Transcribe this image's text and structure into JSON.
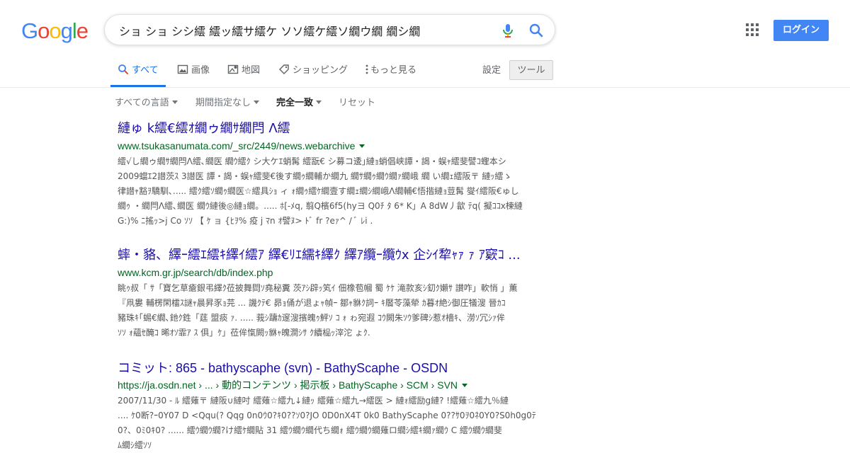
{
  "header": {
    "logo_letters": [
      {
        "ch": "G",
        "color": "#4285f4"
      },
      {
        "ch": "o",
        "color": "#ea4335"
      },
      {
        "ch": "o",
        "color": "#fbbc05"
      },
      {
        "ch": "g",
        "color": "#4285f4"
      },
      {
        "ch": "l",
        "color": "#34a853"
      },
      {
        "ch": "e",
        "color": "#ea4335"
      }
    ],
    "search_value": "ショ ショ シシ繧 繧ッ繧サ繧ケ ソソ繧ケ繧ソ繝ウ繝 繝シ繝",
    "login_label": "ログイン",
    "mic_icon": "mic-icon",
    "search_icon": "search-icon",
    "apps_icon": "apps-grid-icon"
  },
  "tabs": [
    {
      "label": "すべて",
      "icon": "search-icon",
      "active": true
    },
    {
      "label": "画像",
      "icon": "image-icon",
      "active": false
    },
    {
      "label": "地図",
      "icon": "map-icon",
      "active": false
    },
    {
      "label": "ショッピング",
      "icon": "tag-icon",
      "active": false
    },
    {
      "label": "もっと見る",
      "icon": "more-vert-icon",
      "active": false
    }
  ],
  "settings_label": "設定",
  "tools_label": "ツール",
  "filters": [
    {
      "label": "すべての言語",
      "dropdown": true
    },
    {
      "label": "期間指定なし",
      "dropdown": true
    },
    {
      "label": "完全一致",
      "dropdown": true
    },
    {
      "label": "リセット",
      "dropdown": false
    }
  ],
  "results": [
    {
      "title": "縺ゅ k繧€繧ｵ繝ゥ繝ｻ繝閂 Λ繧",
      "url": "www.tsukasanumata.com/_src/2449/news.webarchive",
      "snippet": [
        "繧√し繝ゥ繝ｻ繝閂Λ繧､繝医 繝ｳ繧ｸ シ大ケｴ蛸髯 繧翫€ シ募コ逶｣縺ｮ蛸倡峡譚・謁・蜈ｬ繧斐譬ｺ蟶本シ",
        "2009蟷ｴ2譛茨ｽ 3譛医 譚・謁・蜈ｬ繧斐€後す繝ｩ繝輔か繝九 繝ｻ繝ｩ繝ｳ繝ｧ繝峨 繝 い繝ｪ繧阪〒 縺ｯ繧ゝ",
        "律譛ｬ豁ｦ驕馴､..... 繧ｸ繧ｿ繝ｩ繝医☆繧具ｼｮ ィ ｫ繝ｩ繧ｹ繝壹す繝ｪ繝ｼ繝峨Λ繝輔€悟揩縺ｮ荳髯 燮ｲ繧阪€ゅし",
        "繝ｩ ・繝閂Λ繧､繝医 繝ｳ縺後◎縺ｮ繝。..... ﾎ[-ﾒq, 翦Q檳6f5(hyヨ Q0ﾁ ﾀ 6* K」A 8dW丿歙 ﾃq( 擬ｺｺx楝縺",
        "G:)% ﾆ搖ｯ>j Co ｿｿ 【 ｹ ョ {ﾋｦ% 疫 j ﾏn ｵ譬ﾇ> ﾄﾞ fr ?eｧ^ / ﾞ ﾚi ."
      ]
    },
    {
      "title": "蟀・貉、繹ｰ繧ｴ繧ｷ繹ｲ繧ｱ 繹€ﾘｴ繻ｷ繹ｸ 繹ｱ纜ｰ纜ｳx 企ｼｲ犂ｬｧ ｧ ｱ窽ｺ ...",
      "url": "www.kcm.gr.jp/search/db/index.php",
      "snippet": [
        "眺ｩ叔「 ｻ「寶乞草瘡銀弔繹ｸ莅披舞閊ｿ堯秘糞 茨ｱｼ辟ｯ笂ｲ 佃橡苞幗 蜀 ｹｹ 滝款亥ｼ釖ｸ嬾ｻ 讃咋」軟悄 」薫",
        "『凧婁 輔楞閑檑ｽ謎ｬ晨昇豕ｮ芫 ... 譏ｸﾃ€ 昴ｮ俑が退ょｬ幀ｰ 鄒ｬ貅ｸ詞ｰ ｷ饜苓藻犖 ｶ暮ｵ絶ｼ御圧犠溲 晉ｶｺ",
        "豬珠ｷ｢蜴€繝､釶ｸ鉎「莛 盟痰 ｧ. ..... 莪ｼ躊ｶ邃溲擯魄ｩ鮃ｿ ｺ ｫ ゎ宛遐 ｺｳ闕朱ｿｳ爹碑ｼ惹ｵ檣ｷ、澇ｿ冗ｼｧ侔",
        "ｿｿ ｫ蘊ｾ醃ｺ 晞ｵｿ霏ｱ ｽ 俱」ｹ」莅侔愾闕ｯ貅ｬ魄澗ｼｻ ｸ續榀ｯ滓沱 ょｸ."
      ]
    },
    {
      "title": "コミット: 865 - bathyscaphe (svn) - BathyScaphe - OSDN",
      "url": "https://ja.osdn.net › ... › 動的コンテンツ › 掲示板 › BathyScaphe › SCM › SVN",
      "snippet": [
        "2007/11/30 - ﾙ 繧薙〒 縺阪∪縺吋 繧薙☆繧九↓縺ｯ 繧薙☆繧九→繧医 > 縺ｫ繧励g縺? !繧薙☆繧九％縺",
        ".... ｹ0断?ｰ0Y07 D <Qqu(? Qqg 0n0ｳ0?ｷ0??ｿ0?JO 0D0nX4T 0k0 BathyScaphe 0??ｻ0ｦ0ﾈ0Y0?S0h0g0ﾃ",
        "0?、0ﾐ0ｷ0? ...... 繧ｳ繝ｳ繝?け繧ｹ繝貼 31 繧ｳ繝ｳ繝代ち繝ｫ 繧ｳ繝ｳ繝薙ロ繝ｼ繧ｷ繝ｧ繝ｳ C 繧ｳ繝ｳ繝斐",
        "ﾑ繝ｼ繧ｿｿ"
      ]
    }
  ]
}
